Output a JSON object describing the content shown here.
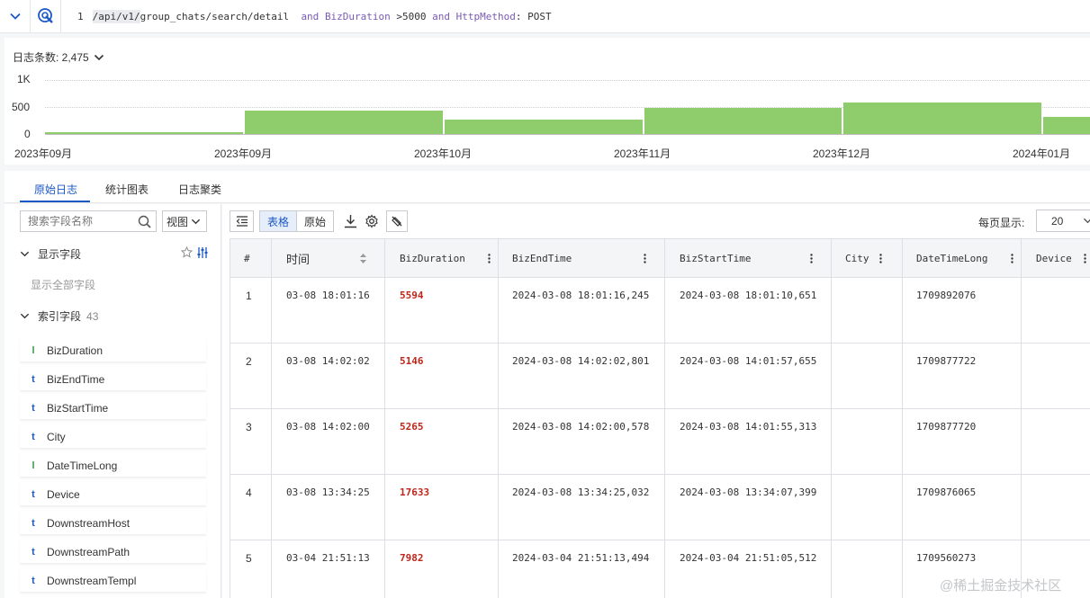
{
  "query": {
    "line_number": "1",
    "path": "/api/v1/",
    "path_rest": "group_chats/search/detail",
    "and1": "and",
    "field1": "BizDuration",
    "op1": ">5000",
    "and2": "and",
    "field2": "HttpMethod",
    "op2": ": POST"
  },
  "histogram": {
    "count_label": "日志条数: 2,475",
    "y_ticks": [
      "1K",
      "500",
      "0"
    ],
    "x_labels": [
      "2023年09月",
      "2023年09月",
      "2023年10月",
      "2023年11月",
      "2023年12月",
      "2024年01月"
    ]
  },
  "chart_data": {
    "type": "bar",
    "title": "",
    "xlabel": "",
    "ylabel": "",
    "ylim": [
      0,
      1000
    ],
    "categories": [
      "2023年09月",
      "2023年09月",
      "2023年10月",
      "2023年11月",
      "2023年12月",
      "2024年01月"
    ],
    "values": [
      40,
      430,
      260,
      480,
      580,
      310
    ],
    "bar_color": "#8fcc6b",
    "grid": true
  },
  "tabs": [
    "原始日志",
    "统计图表",
    "日志聚类"
  ],
  "sidebar": {
    "search_placeholder": "搜索字段名称",
    "view_label": "视图",
    "shown_fields_label": "显示字段",
    "show_all_label": "显示全部字段",
    "index_fields_label": "索引字段",
    "index_fields_count": "43",
    "fields": [
      {
        "type": "l",
        "name": "BizDuration"
      },
      {
        "type": "t",
        "name": "BizEndTime"
      },
      {
        "type": "t",
        "name": "BizStartTime"
      },
      {
        "type": "t",
        "name": "City"
      },
      {
        "type": "l",
        "name": "DateTimeLong"
      },
      {
        "type": "t",
        "name": "Device"
      },
      {
        "type": "t",
        "name": "DownstreamHost"
      },
      {
        "type": "t",
        "name": "DownstreamPath"
      },
      {
        "type": "t",
        "name": "DownstreamTempl"
      }
    ]
  },
  "toolbar": {
    "table_label": "表格",
    "raw_label": "原始",
    "per_page_label": "每页显示:",
    "per_page_value": "20"
  },
  "table": {
    "columns": [
      "#",
      "时间",
      "BizDuration",
      "BizEndTime",
      "BizStartTime",
      "City",
      "DateTimeLong",
      "Device"
    ],
    "rows": [
      {
        "idx": "1",
        "time": "03-08 18:01:16",
        "dur": "5594",
        "end": "2024-03-08 18:01:16,245",
        "start": "2024-03-08 18:01:10,651",
        "city": "",
        "dtl": "1709892076",
        "device": ""
      },
      {
        "idx": "2",
        "time": "03-08 14:02:02",
        "dur": "5146",
        "end": "2024-03-08 14:02:02,801",
        "start": "2024-03-08 14:01:57,655",
        "city": "",
        "dtl": "1709877722",
        "device": ""
      },
      {
        "idx": "3",
        "time": "03-08 14:02:00",
        "dur": "5265",
        "end": "2024-03-08 14:02:00,578",
        "start": "2024-03-08 14:01:55,313",
        "city": "",
        "dtl": "1709877720",
        "device": ""
      },
      {
        "idx": "4",
        "time": "03-08 13:34:25",
        "dur": "17633",
        "end": "2024-03-08 13:34:25,032",
        "start": "2024-03-08 13:34:07,399",
        "city": "",
        "dtl": "1709876065",
        "device": ""
      },
      {
        "idx": "5",
        "time": "03-04 21:51:13",
        "dur": "7982",
        "end": "2024-03-04 21:51:13,494",
        "start": "2024-03-04 21:51:05,512",
        "city": "",
        "dtl": "1709560273",
        "device": ""
      }
    ]
  },
  "watermark": "@稀土掘金技术社区"
}
